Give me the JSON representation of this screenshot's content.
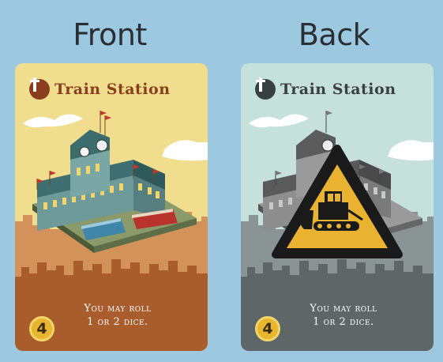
{
  "labels": {
    "front": "Front",
    "back": "Back"
  },
  "cards": {
    "front": {
      "title": "Train Station",
      "title_icon": "tower-icon",
      "rule_line1": "You may roll",
      "rule_line2": "1 or 2 dice.",
      "cost": "4",
      "colors": {
        "sky": "#f0de8e",
        "ground": "#a95c2c",
        "skyline": "#d2925a",
        "title": "#8a3e1e"
      }
    },
    "back": {
      "title": "Train Station",
      "title_icon": "tower-icon",
      "rule_line1": "You may roll",
      "rule_line2": "1 or 2 dice.",
      "cost": "4",
      "overlay_icon": "construction-warning-icon",
      "colors": {
        "sky": "#c6e0dc",
        "ground": "#5e6668",
        "skyline": "#8a9494",
        "title": "#3a3f42"
      }
    }
  }
}
